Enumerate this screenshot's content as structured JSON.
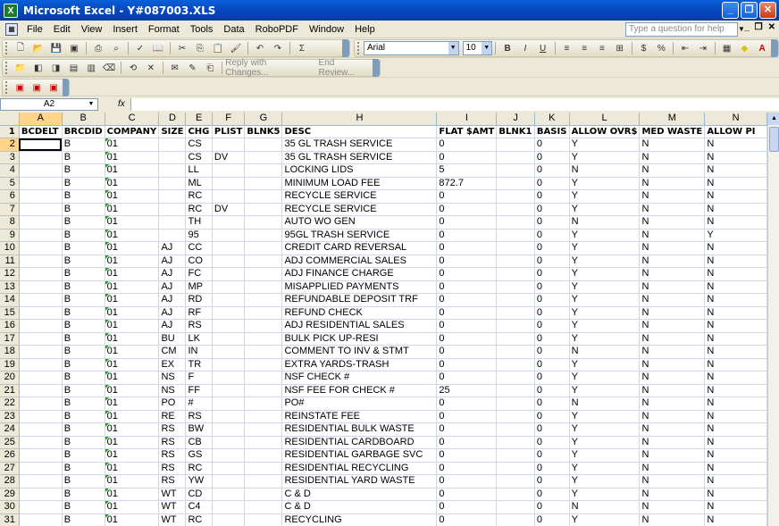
{
  "window": {
    "title": "Microsoft Excel - Y#087003.XLS",
    "app_icon": "X"
  },
  "menu": [
    "File",
    "Edit",
    "View",
    "Insert",
    "Format",
    "Tools",
    "Data",
    "RoboPDF",
    "Window",
    "Help"
  ],
  "help_placeholder": "Type a question for help",
  "formatting": {
    "font_name": "Arial",
    "font_size": "10"
  },
  "review_bar": {
    "reply_label": "Reply with Changes...",
    "end_label": "End Review..."
  },
  "name_box": "A2",
  "fx_label": "fx",
  "columns": [
    "A",
    "B",
    "C",
    "D",
    "E",
    "F",
    "G",
    "H",
    "I",
    "J",
    "K",
    "L",
    "M",
    "N"
  ],
  "rows": [
    [
      "BCDELT",
      "BRCDID",
      "COMPANY",
      "SIZE",
      "CHG",
      "PLIST",
      "BLNK5",
      "DESC",
      "FLAT $AMT",
      "BLNK1",
      "BASIS",
      "ALLOW OVR$",
      "MED WASTE",
      "ALLOW PI"
    ],
    [
      "",
      "B",
      "01",
      "",
      "CS",
      "",
      "",
      "35 GL TRASH SERVICE",
      "0",
      "",
      "0",
      "Y",
      "N",
      "N"
    ],
    [
      "",
      "B",
      "01",
      "",
      "CS",
      "DV",
      "",
      "35 GL TRASH SERVICE",
      "0",
      "",
      "0",
      "Y",
      "N",
      "N"
    ],
    [
      "",
      "B",
      "01",
      "",
      "LL",
      "",
      "",
      "LOCKING LIDS",
      "5",
      "",
      "0",
      "N",
      "N",
      "N"
    ],
    [
      "",
      "B",
      "01",
      "",
      "ML",
      "",
      "",
      "MINIMUM LOAD FEE",
      "872.7",
      "",
      "0",
      "Y",
      "N",
      "N"
    ],
    [
      "",
      "B",
      "01",
      "",
      "RC",
      "",
      "",
      "RECYCLE SERVICE",
      "0",
      "",
      "0",
      "Y",
      "N",
      "N"
    ],
    [
      "",
      "B",
      "01",
      "",
      "RC",
      "DV",
      "",
      "RECYCLE SERVICE",
      "0",
      "",
      "0",
      "Y",
      "N",
      "N"
    ],
    [
      "",
      "B",
      "01",
      "",
      "TH",
      "",
      "",
      "AUTO WO GEN",
      "0",
      "",
      "0",
      "N",
      "N",
      "N"
    ],
    [
      "",
      "B",
      "01",
      "",
      "95",
      "",
      "",
      "95GL TRASH SERVICE",
      "0",
      "",
      "0",
      "Y",
      "N",
      "Y"
    ],
    [
      "",
      "B",
      "01",
      "AJ",
      "CC",
      "",
      "",
      "CREDIT CARD REVERSAL",
      "0",
      "",
      "0",
      "Y",
      "N",
      "N"
    ],
    [
      "",
      "B",
      "01",
      "AJ",
      "CO",
      "",
      "",
      "ADJ COMMERCIAL SALES",
      "0",
      "",
      "0",
      "Y",
      "N",
      "N"
    ],
    [
      "",
      "B",
      "01",
      "AJ",
      "FC",
      "",
      "",
      "ADJ FINANCE CHARGE",
      "0",
      "",
      "0",
      "Y",
      "N",
      "N"
    ],
    [
      "",
      "B",
      "01",
      "AJ",
      "MP",
      "",
      "",
      "MISAPPLIED PAYMENTS",
      "0",
      "",
      "0",
      "Y",
      "N",
      "N"
    ],
    [
      "",
      "B",
      "01",
      "AJ",
      "RD",
      "",
      "",
      "REFUNDABLE DEPOSIT TRF",
      "0",
      "",
      "0",
      "Y",
      "N",
      "N"
    ],
    [
      "",
      "B",
      "01",
      "AJ",
      "RF",
      "",
      "",
      "REFUND CHECK",
      "0",
      "",
      "0",
      "Y",
      "N",
      "N"
    ],
    [
      "",
      "B",
      "01",
      "AJ",
      "RS",
      "",
      "",
      "ADJ RESIDENTIAL SALES",
      "0",
      "",
      "0",
      "Y",
      "N",
      "N"
    ],
    [
      "",
      "B",
      "01",
      "BU",
      "LK",
      "",
      "",
      "BULK PICK UP-RESI",
      "0",
      "",
      "0",
      "Y",
      "N",
      "N"
    ],
    [
      "",
      "B",
      "01",
      "CM",
      "IN",
      "",
      "",
      "COMMENT TO INV & STMT",
      "0",
      "",
      "0",
      "N",
      "N",
      "N"
    ],
    [
      "",
      "B",
      "01",
      "EX",
      "TR",
      "",
      "",
      "EXTRA YARDS-TRASH",
      "0",
      "",
      "0",
      "Y",
      "N",
      "N"
    ],
    [
      "",
      "B",
      "01",
      "NS",
      "F",
      "",
      "",
      "NSF CHECK #",
      "0",
      "",
      "0",
      "Y",
      "N",
      "N"
    ],
    [
      "",
      "B",
      "01",
      "NS",
      "FF",
      "",
      "",
      "NSF FEE  FOR CHECK #",
      "25",
      "",
      "0",
      "Y",
      "N",
      "N"
    ],
    [
      "",
      "B",
      "01",
      "PO",
      "#",
      "",
      "",
      "PO#",
      "0",
      "",
      "0",
      "N",
      "N",
      "N"
    ],
    [
      "",
      "B",
      "01",
      "RE",
      "RS",
      "",
      "",
      "REINSTATE FEE",
      "0",
      "",
      "0",
      "Y",
      "N",
      "N"
    ],
    [
      "",
      "B",
      "01",
      "RS",
      "BW",
      "",
      "",
      "RESIDENTIAL BULK WASTE",
      "0",
      "",
      "0",
      "Y",
      "N",
      "N"
    ],
    [
      "",
      "B",
      "01",
      "RS",
      "CB",
      "",
      "",
      "RESIDENTIAL CARDBOARD",
      "0",
      "",
      "0",
      "Y",
      "N",
      "N"
    ],
    [
      "",
      "B",
      "01",
      "RS",
      "GS",
      "",
      "",
      "RESIDENTIAL GARBAGE SVC",
      "0",
      "",
      "0",
      "Y",
      "N",
      "N"
    ],
    [
      "",
      "B",
      "01",
      "RS",
      "RC",
      "",
      "",
      "RESIDENTIAL RECYCLING",
      "0",
      "",
      "0",
      "Y",
      "N",
      "N"
    ],
    [
      "",
      "B",
      "01",
      "RS",
      "YW",
      "",
      "",
      "RESIDENTIAL YARD WASTE",
      "0",
      "",
      "0",
      "Y",
      "N",
      "N"
    ],
    [
      "",
      "B",
      "01",
      "WT",
      "CD",
      "",
      "",
      "C & D",
      "0",
      "",
      "0",
      "Y",
      "N",
      "N"
    ],
    [
      "",
      "B",
      "01",
      "WT",
      "C4",
      "",
      "",
      "C & D",
      "0",
      "",
      "0",
      "N",
      "N",
      "N"
    ],
    [
      "",
      "B",
      "01",
      "WT",
      "RC",
      "",
      "",
      "RECYCLING",
      "0",
      "",
      "0",
      "Y",
      "N",
      "N"
    ]
  ],
  "selected": {
    "col": "A",
    "row": 2
  }
}
